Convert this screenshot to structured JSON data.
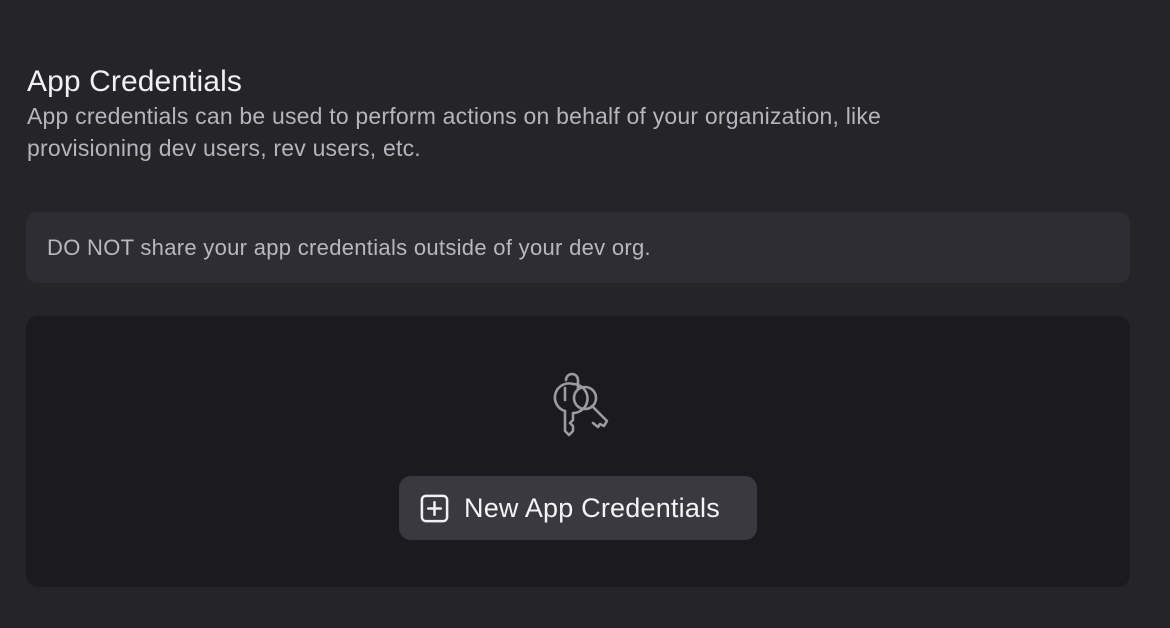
{
  "section": {
    "title": "App Credentials",
    "description": "App credentials can be used to perform actions on behalf of your organization, like provisioning dev users, rev users, etc."
  },
  "warning": {
    "text": "DO NOT share your app credentials outside of your dev org."
  },
  "empty_state": {
    "icon": "keys-icon",
    "button_icon": "plus-square-icon",
    "button_label": "New App Credentials"
  },
  "colors": {
    "background": "#252429",
    "panel": "#1b1b1f",
    "warning_bg": "#2e2d33",
    "button_bg": "#3a3940"
  }
}
